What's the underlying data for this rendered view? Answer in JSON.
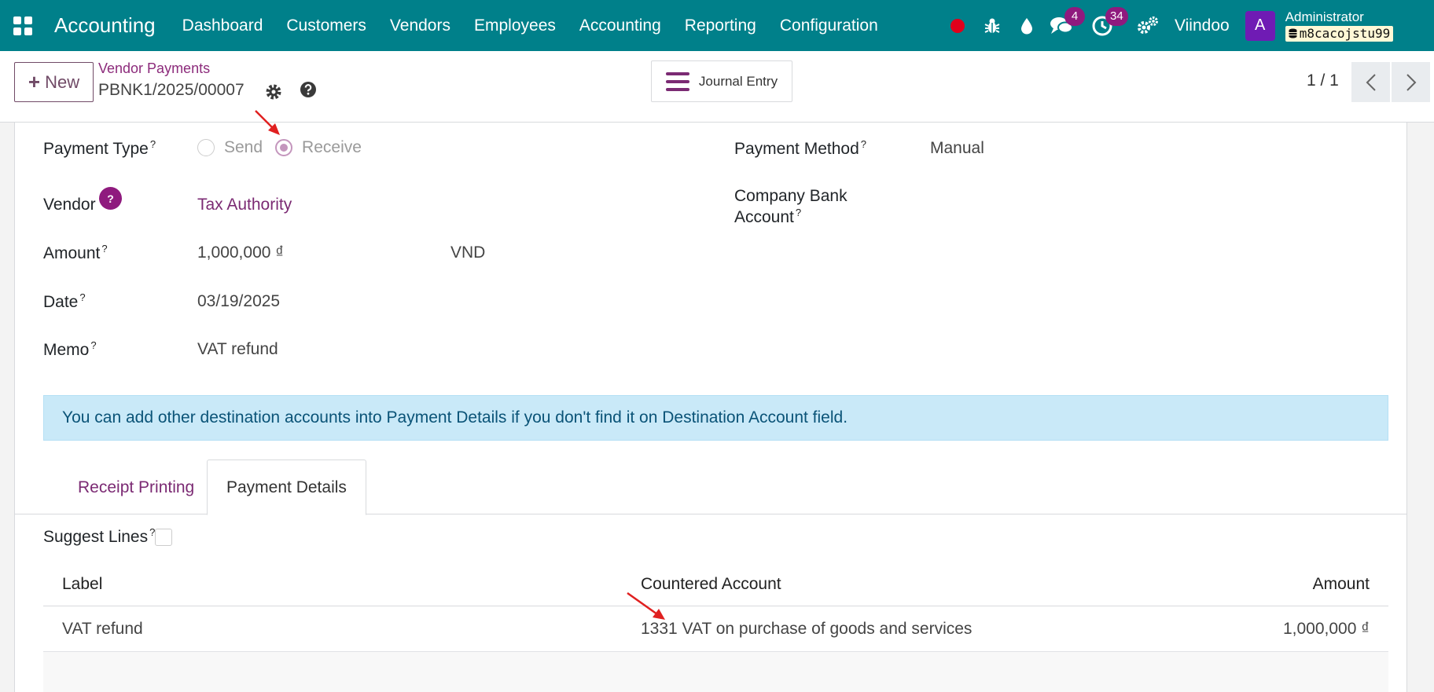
{
  "navbar": {
    "brand": "Accounting",
    "menu": [
      "Dashboard",
      "Customers",
      "Vendors",
      "Employees",
      "Accounting",
      "Reporting",
      "Configuration"
    ],
    "messages_count": "4",
    "activities_count": "34",
    "company": "Viindoo",
    "avatar_letter": "A",
    "user": "Administrator",
    "database": "m8cacojstu99"
  },
  "control_panel": {
    "new_label": "New",
    "breadcrumb_parent": "Vendor Payments",
    "record_name": "PBNK1/2025/00007",
    "journal_entry_label": "Journal Entry",
    "pager": "1 / 1"
  },
  "form": {
    "payment_type_label": "Payment Type",
    "payment_type_options": [
      "Send",
      "Receive"
    ],
    "payment_type_selected": "Receive",
    "vendor_label": "Vendor",
    "vendor_help": "?",
    "vendor_value": "Tax Authority",
    "amount_label": "Amount",
    "amount_value": "1,000,000 ₫",
    "currency_value": "VND",
    "date_label": "Date",
    "date_value": "03/19/2025",
    "memo_label": "Memo",
    "memo_value": "VAT refund",
    "payment_method_label": "Payment Method",
    "payment_method_value": "Manual",
    "bank_account_label_1": "Company Bank",
    "bank_account_label_2": "Account",
    "tooltip_marker": "?"
  },
  "alert_text": "You can add other destination accounts into Payment Details if you don't find it on Destination Account field.",
  "tabs": [
    "Receipt Printing",
    "Payment Details"
  ],
  "active_tab": "Payment Details",
  "payment_details": {
    "suggest_lines_label": "Suggest Lines",
    "columns": [
      "Label",
      "Countered Account",
      "Amount"
    ],
    "rows": [
      {
        "label": "VAT refund",
        "account": "1331 VAT on purchase of goods and services",
        "amount": "1,000,000 ₫"
      }
    ]
  },
  "colors": {
    "navbar": "#00808a",
    "brand_purple": "#714b67",
    "link": "#7b2a73",
    "alert_bg": "#c9e9f8",
    "annotation_arrow": "#e02020"
  }
}
